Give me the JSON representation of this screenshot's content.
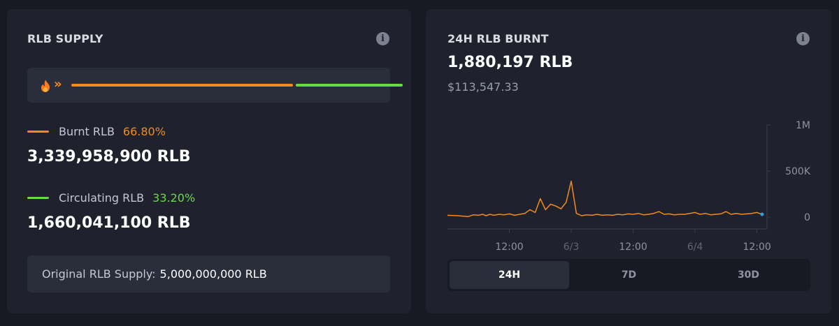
{
  "supply": {
    "title": "RLB SUPPLY",
    "info_icon": "info-icon",
    "fire_icon": "fire-icon",
    "arrows": "»",
    "burnt": {
      "label": "Burnt RLB",
      "percent": "66.80%",
      "value": "3,339,958,900 RLB",
      "fraction": 0.668,
      "color": "#f38a1f"
    },
    "circulating": {
      "label": "Circulating RLB",
      "percent": "33.20%",
      "value": "1,660,041,100 RLB",
      "fraction": 0.332,
      "color": "#68dc3f"
    },
    "original_label": "Original RLB Supply:",
    "original_value": "5,000,000,000 RLB"
  },
  "burnt24": {
    "title": "24H RLB BURNT",
    "info_icon": "info-icon",
    "value": "1,880,197 RLB",
    "usd": "$113,547.33"
  },
  "chart_data": {
    "type": "line",
    "x_ticks": [
      "12:00",
      "6/3",
      "12:00",
      "6/4",
      "12:00"
    ],
    "x_tick_pos": [
      12,
      24,
      36,
      48,
      60
    ],
    "y_ticks": [
      "1M",
      "500K",
      "0"
    ],
    "y_tick_values": [
      1000000,
      500000,
      0
    ],
    "ylim": [
      0,
      1000000
    ],
    "xlim": [
      0,
      61
    ],
    "x": [
      0,
      2,
      4,
      5,
      6,
      6.8,
      7.5,
      8.2,
      9,
      10,
      11,
      12,
      13,
      14,
      15,
      16,
      17,
      18,
      19,
      20,
      21,
      22,
      23,
      24,
      25,
      26,
      27,
      28,
      29,
      30,
      31,
      32,
      33,
      34,
      35,
      36,
      37,
      38,
      39,
      40,
      41,
      42,
      43,
      44,
      45,
      46,
      47,
      48,
      49,
      50,
      51,
      52,
      53,
      54,
      55,
      56,
      57,
      58,
      59,
      60,
      61
    ],
    "y": [
      20000,
      15000,
      5000,
      25000,
      20000,
      30000,
      15000,
      30000,
      20000,
      30000,
      25000,
      35000,
      20000,
      30000,
      40000,
      80000,
      50000,
      200000,
      80000,
      140000,
      120000,
      90000,
      160000,
      390000,
      40000,
      15000,
      25000,
      20000,
      30000,
      20000,
      25000,
      20000,
      30000,
      25000,
      35000,
      30000,
      40000,
      25000,
      30000,
      40000,
      60000,
      30000,
      35000,
      25000,
      30000,
      30000,
      40000,
      50000,
      30000,
      40000,
      25000,
      30000,
      35000,
      60000,
      30000,
      40000,
      30000,
      35000,
      40000,
      50000,
      30000
    ],
    "color": "#f38a1f",
    "end_point_color": "#2fa1e0"
  },
  "tabs": [
    {
      "label": "24H",
      "active": true
    },
    {
      "label": "7D",
      "active": false
    },
    {
      "label": "30D",
      "active": false
    }
  ]
}
